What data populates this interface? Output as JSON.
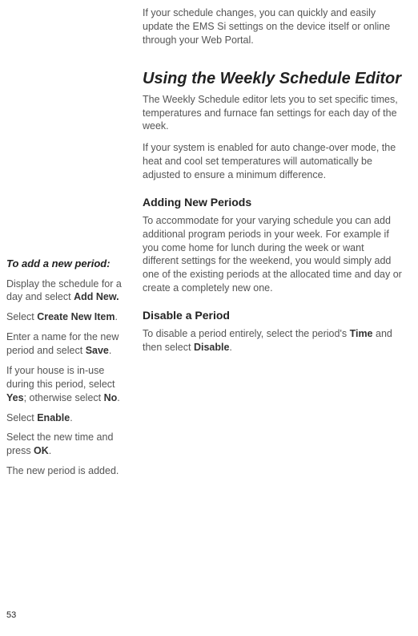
{
  "intro": "If your schedule changes, you can quickly and easily update the EMS Si settings on the device itself or online through your Web Portal.",
  "heading": "Using the Weekly Schedule Editor",
  "para1": "The Weekly Schedule editor lets you to set specific times, temperatures and furnace fan settings for each day of the week.",
  "para2": "If your system is enabled for auto change-over mode, the heat and cool set temperatures will automatically be adjusted to ensure a minimum difference.",
  "sub1": "Adding New Periods",
  "sub1_para": "To accommodate for your varying schedule you can add additional program periods in your week. For example if you come home for lunch during the week or want different settings for the weekend, you would simply add one of the existing periods at the allocated time and day or create a completely new one.",
  "sub2": "Disable a Period",
  "sub2_para_pre": "To disable a period entirely, select the period's ",
  "sub2_para_b1": "Time",
  "sub2_para_mid": " and then select ",
  "sub2_para_b2": "Disable",
  "sub2_para_post": ".",
  "sidebar": {
    "title": "To add a new period:",
    "s1_pre": "Display the schedule for a day and select ",
    "s1_b": "Add New.",
    "s2_pre": "Select ",
    "s2_b": "Create New Item",
    "s2_post": ".",
    "s3_pre": "Enter a name for the new period and select ",
    "s3_b": "Save",
    "s3_post": ".",
    "s4_pre": "If your house is in-use during this period, select ",
    "s4_b1": "Yes",
    "s4_mid": "; otherwise select ",
    "s4_b2": "No",
    "s4_post": ".",
    "s5_pre": "Select ",
    "s5_b": "Enable",
    "s5_post": ".",
    "s6_pre": "Select the new time and press ",
    "s6_b": "OK",
    "s6_post": ".",
    "s7": "The new period is added."
  },
  "page_number": "53"
}
